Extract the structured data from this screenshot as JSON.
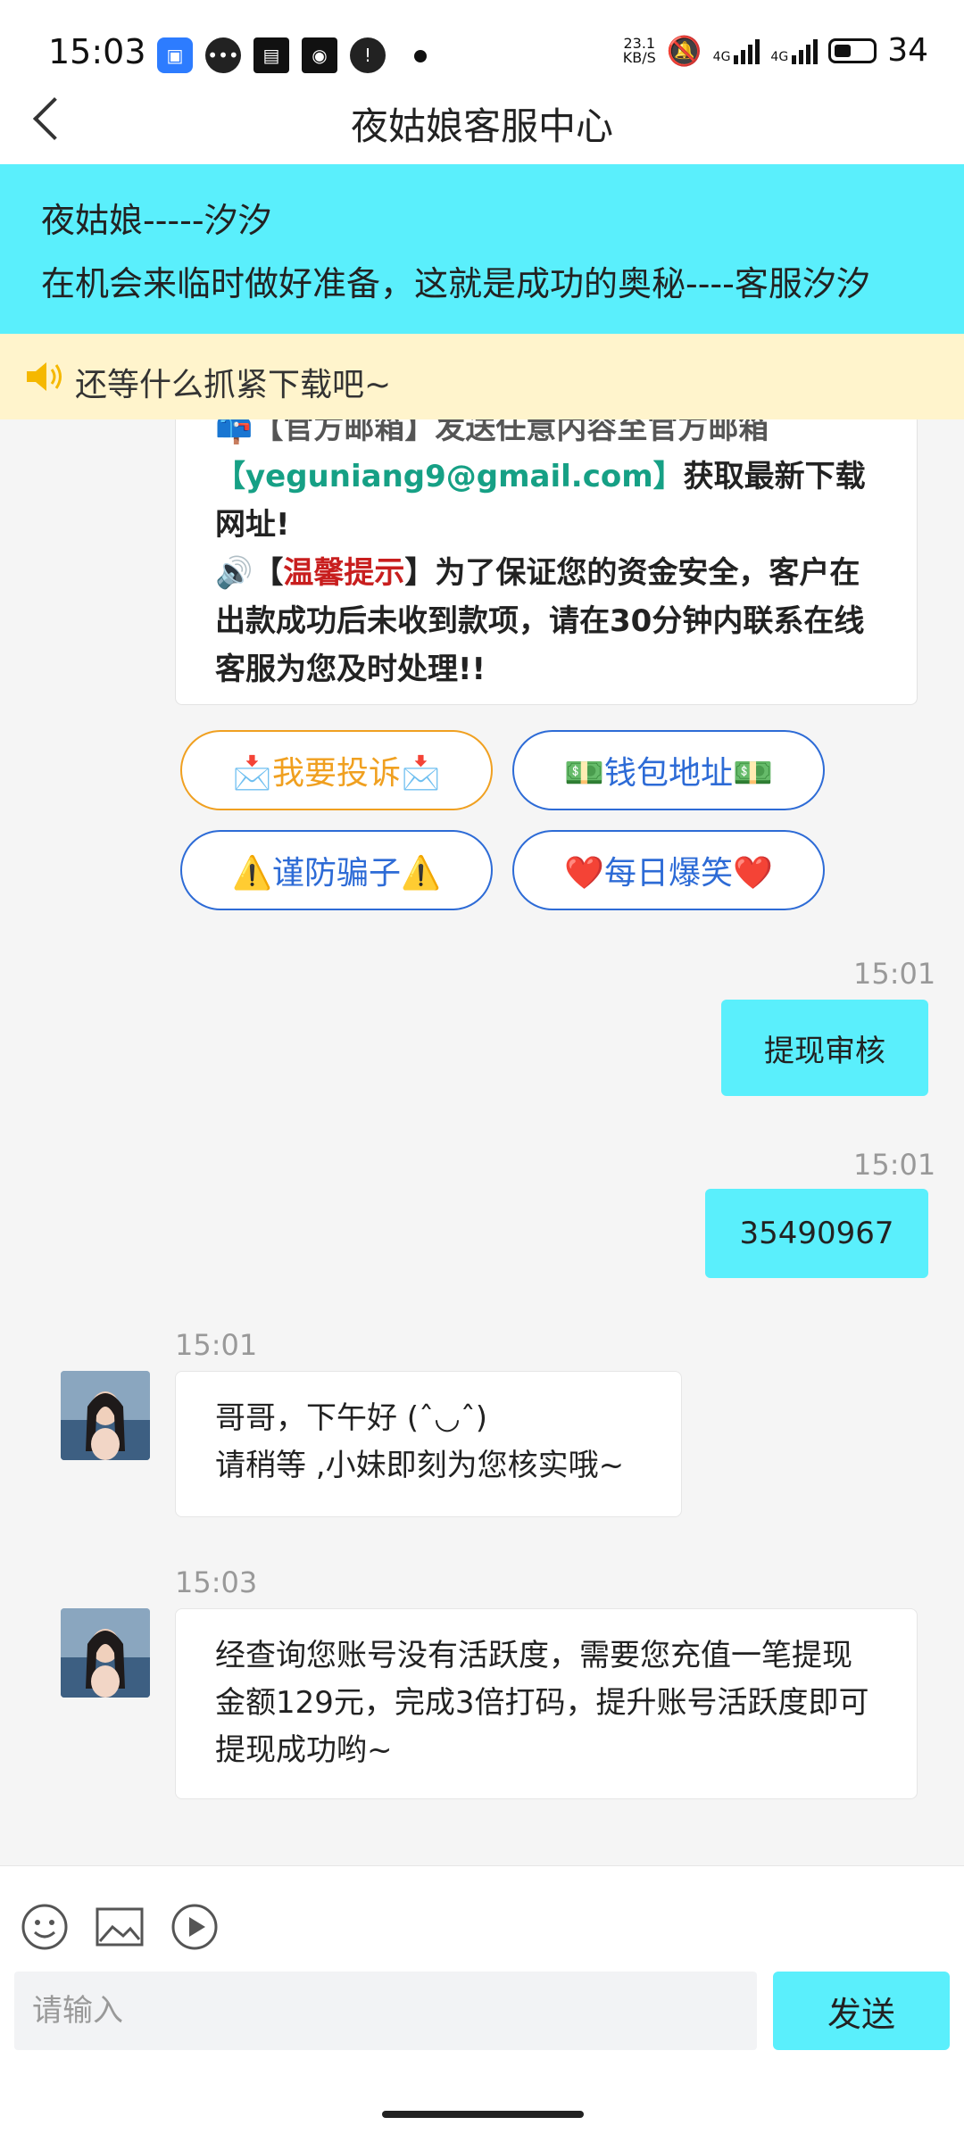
{
  "status_bar": {
    "time": "15:03",
    "net_speed_value": "23.1",
    "net_speed_unit": "KB/S",
    "net_label_1": "4G",
    "net_label_2": "4G",
    "battery": "34"
  },
  "header": {
    "title": "夜姑娘客服中心"
  },
  "banner": {
    "line1": "夜姑娘-----汐汐",
    "line2": "在机会来临时做好准备，这就是成功的奥秘----客服汐汐"
  },
  "notice": {
    "text": "还等什么抓紧下载吧~"
  },
  "announcement": {
    "partial_line_1": "📪【官方邮箱】发送任意内容至官方邮箱",
    "email": "【yeguniang9@gmail.com】",
    "after_email": "获取最新下载网址!",
    "tip_prefix": "🔊【",
    "tip_label": "温馨提示",
    "tip_body": "】为了保证您的资金安全，客户在出款成功后未收到款项，请在30分钟内联系在线客服为您及时处理!!"
  },
  "quick_buttons": [
    {
      "label": "📩我要投诉📩"
    },
    {
      "label": "💵钱包地址💵"
    },
    {
      "label": "⚠️谨防骗子⚠️"
    },
    {
      "label": "❤️每日爆笑❤️"
    }
  ],
  "messages": [
    {
      "time": "15:01",
      "text": "提现审核"
    },
    {
      "time": "15:01",
      "text": "35490967"
    },
    {
      "time": "15:01",
      "line1": "哥哥，下午好 (ˆ◡ˆ)",
      "line2": "请稍等 ,小妹即刻为您核实哦~"
    },
    {
      "time": "15:03",
      "text": "经查询您账号没有活跃度，需要您充值一笔提现金额129元，完成3倍打码，提升账号活跃度即可提现成功哟~"
    }
  ],
  "input": {
    "placeholder": "请输入",
    "send_label": "发送"
  },
  "icons": {
    "back": "back-icon",
    "speaker": "speaker-icon",
    "emoji": "emoji-icon",
    "image": "image-icon",
    "video": "play-icon"
  }
}
